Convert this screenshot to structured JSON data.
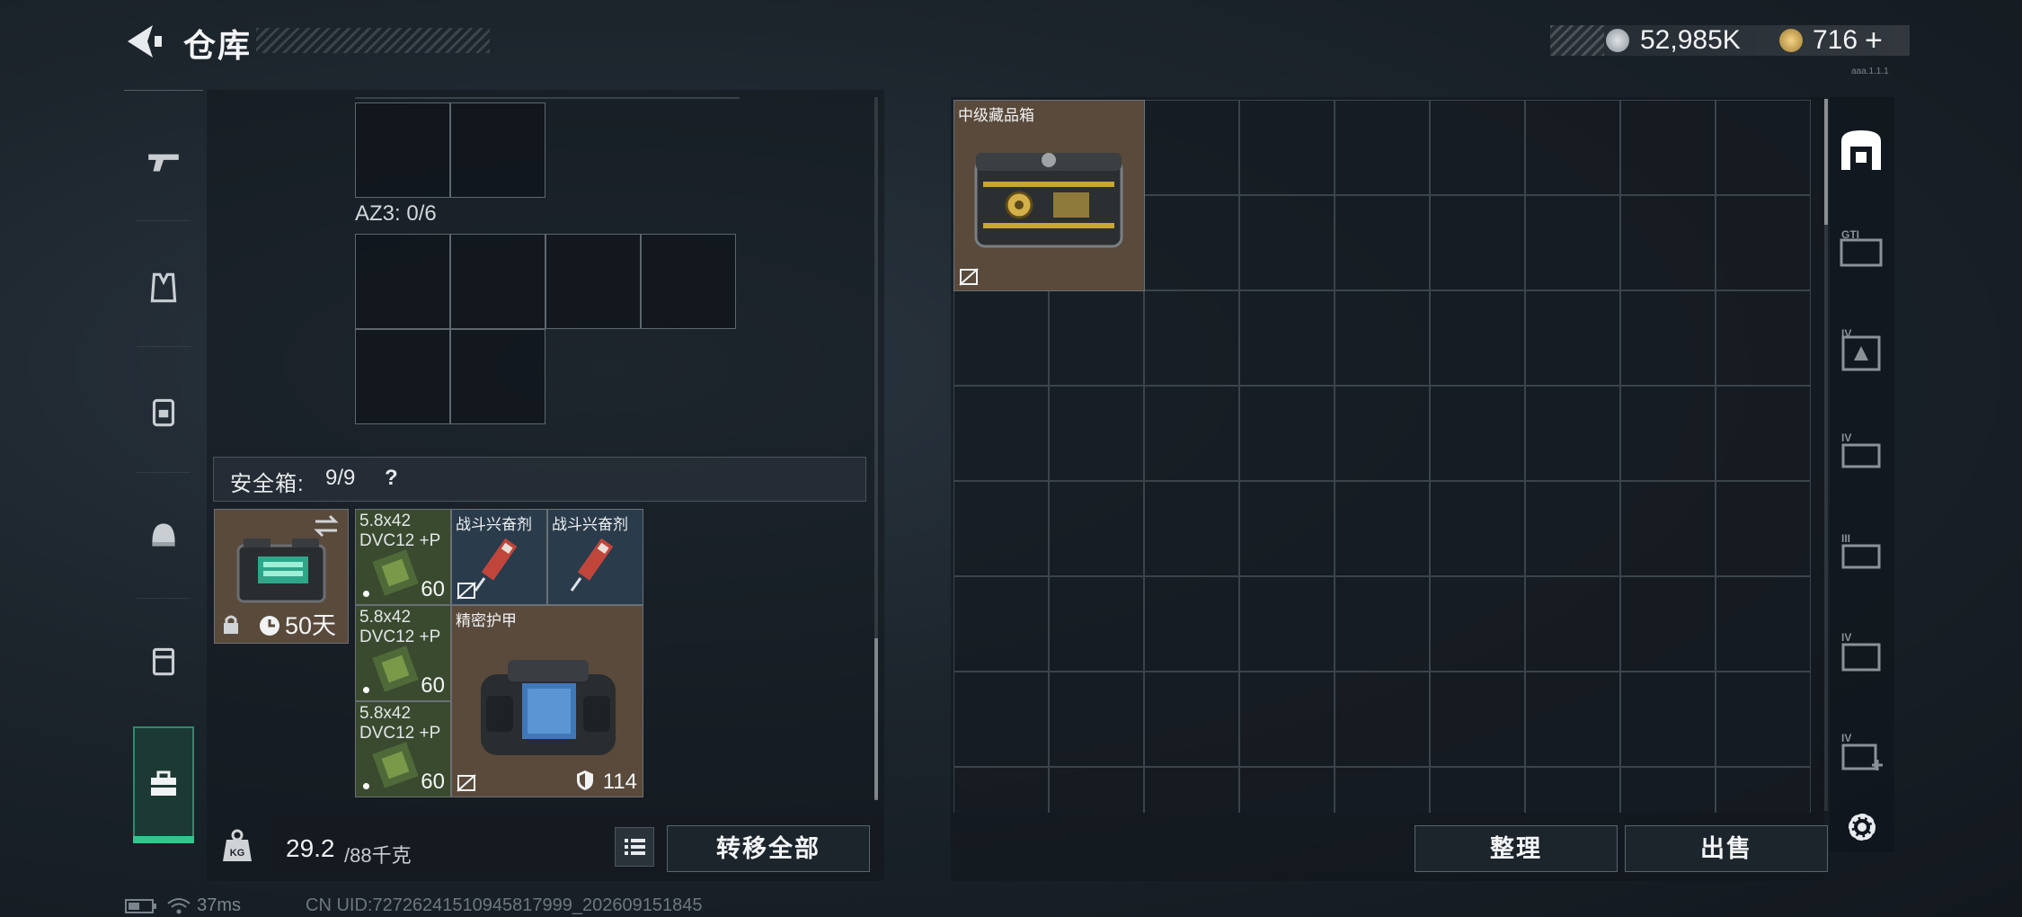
{
  "header": {
    "title": "仓库",
    "silver_amount": "52,985K",
    "gold_amount": "716",
    "gold_add": "+",
    "build_tag": "aaa.1.1.1"
  },
  "sidebar": {
    "items": [
      "pistol-icon",
      "vest-icon",
      "backpack-icon",
      "helmet-icon",
      "pouch-icon",
      "toolbox-icon"
    ],
    "active_index": 5
  },
  "left_panel": {
    "az3_label": "AZ3: 0/6",
    "safe_box": {
      "label": "安全箱:",
      "count": "9/9",
      "help": "?",
      "container_duration": "50天",
      "items": [
        {
          "name": "5.8x42",
          "sub": "DVC12 +P",
          "qty": "60"
        },
        {
          "name": "战斗兴奋剂",
          "qty": ""
        },
        {
          "name": "战斗兴奋剂",
          "qty": ""
        },
        {
          "name": "5.8x42",
          "sub": "DVC12 +P",
          "qty": "60"
        },
        {
          "name": "精密护甲",
          "durability": "114"
        },
        {
          "name": "5.8x42",
          "sub": "DVC12 +P",
          "qty": "60"
        }
      ]
    },
    "weight": {
      "current": "29.2",
      "max": "/88千克"
    },
    "transfer_all": "转移全部"
  },
  "right_panel": {
    "item_name": "中级藏品箱",
    "sort_button": "整理",
    "sell_button": "出售"
  },
  "right_sidebar": {
    "items": [
      "storage-icon",
      "g1-icon",
      "iv-icon-1",
      "iv-icon-2",
      "iii-icon",
      "iv-icon-3",
      "iv-plus-icon"
    ]
  },
  "status_bar": {
    "ping": "37ms",
    "uid": "CN UID:72726241510945817999_202609151845"
  },
  "colors": {
    "accent_green": "#34c48e",
    "item_brown": "#5a4a3c",
    "item_blue": "#2a3b4c",
    "item_green": "#3a4a2f"
  }
}
